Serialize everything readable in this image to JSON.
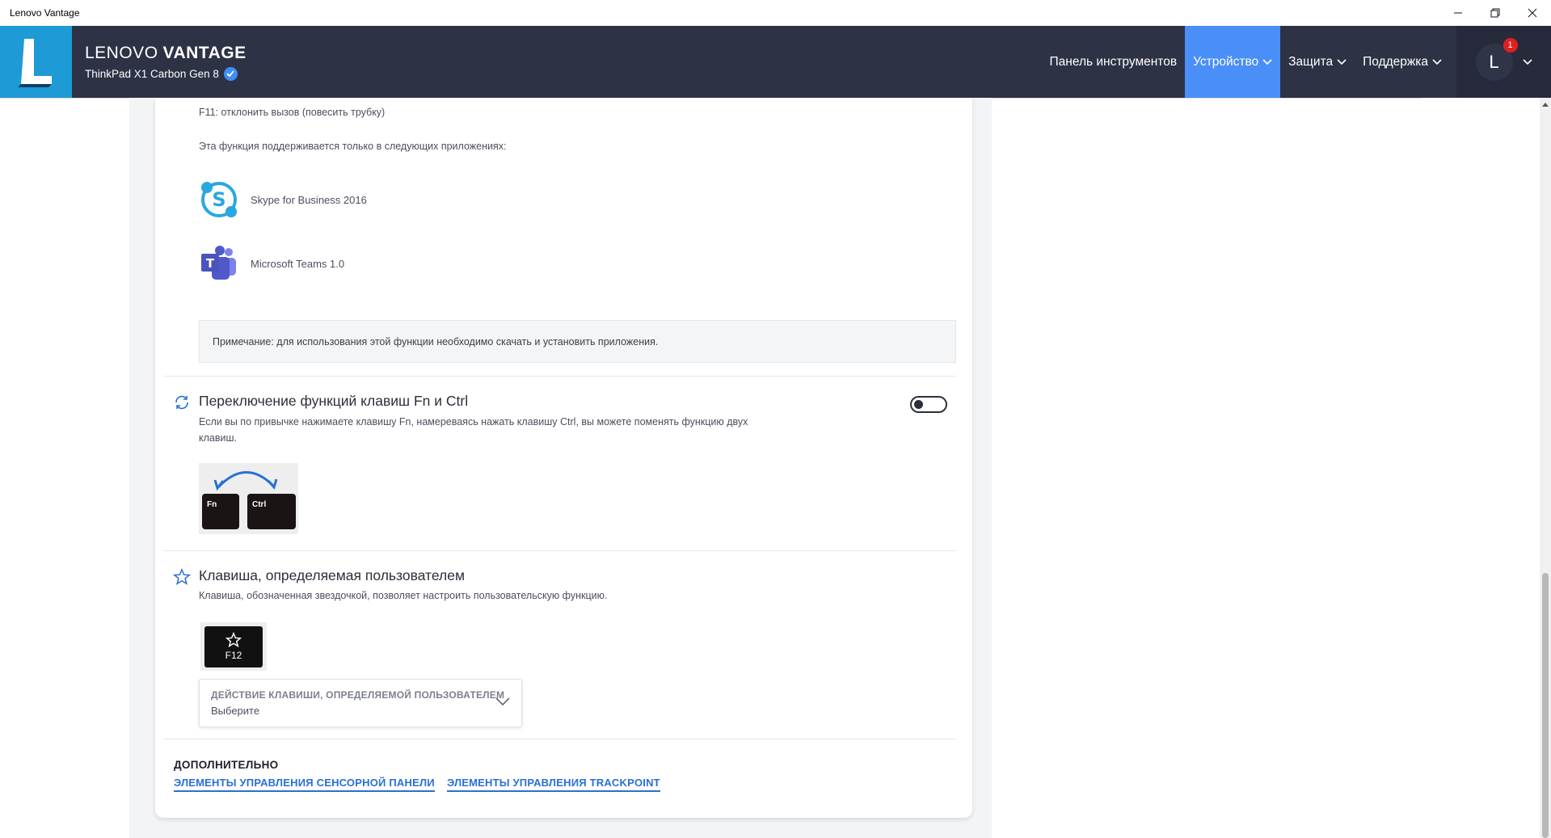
{
  "window": {
    "title": "Lenovo Vantage",
    "controls": [
      "minimize",
      "restore",
      "close"
    ]
  },
  "header": {
    "brand_light": "LENOVO",
    "brand_bold": "VANTAGE",
    "device": "ThinkPad X1 Carbon Gen 8",
    "nav": [
      {
        "label": "Панель инструментов",
        "active": false,
        "dropdown": false
      },
      {
        "label": "Устройство",
        "active": true,
        "dropdown": true
      },
      {
        "label": "Защита",
        "active": false,
        "dropdown": true
      },
      {
        "label": "Поддержка",
        "active": false,
        "dropdown": true
      }
    ],
    "account": {
      "initial": "L",
      "notifications": "1"
    },
    "colors": {
      "header_bg": "#2d3245",
      "logo_bg": "#1e9ad6",
      "active_nav": "#4a8ef7",
      "badge": "#e02020"
    }
  },
  "content": {
    "f11_text": "F11: отклонить вызов (повесить трубку)",
    "supported_text": "Эта функция поддерживается только в следующих приложениях:",
    "apps": [
      {
        "name": "Skype for Business 2016",
        "icon": "skype-icon"
      },
      {
        "name": "Microsoft Teams 1.0",
        "icon": "teams-icon"
      }
    ],
    "note": "Примечание: для использования этой функции необходимо скачать и установить приложения.",
    "fn_ctrl": {
      "title": "Переключение функций клавиш Fn и Ctrl",
      "description_line1": "Если вы по привычке нажимаете клавишу Fn, намереваясь нажать клавишу Ctrl, вы можете поменять функцию двух",
      "description_line2": "клавиш.",
      "toggle_on": false,
      "key_fn": "Fn",
      "key_ctrl": "Ctrl"
    },
    "custom_key": {
      "title": "Клавиша, определяемая пользователем",
      "description": "Клавиша, обозначенная звездочкой, позволяет настроить пользовательскую функцию.",
      "key_label": "F12",
      "dropdown_label": "ДЕЙСТВИЕ КЛАВИШИ, ОПРЕДЕЛЯЕМОЙ ПОЛЬЗОВАТЕЛЕМ",
      "dropdown_value": "Выберите"
    },
    "additional": {
      "title": "ДОПОЛНИТЕЛЬНО",
      "links": [
        "ЭЛЕМЕНТЫ УПРАВЛЕНИЯ СЕНСОРНОЙ ПАНЕЛИ",
        "ЭЛЕМЕНТЫ УПРАВЛЕНИЯ TRACKPOINT"
      ]
    },
    "colors": {
      "link": "#2a6fd6",
      "icon_blue": "#2a6fd6"
    }
  }
}
